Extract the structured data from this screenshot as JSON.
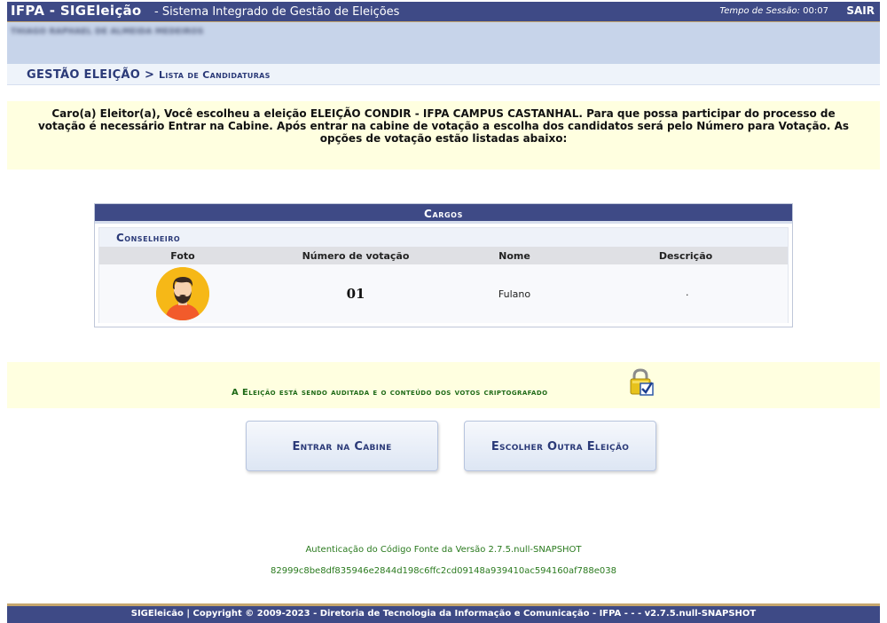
{
  "topbar": {
    "brand": "IFPA - SIGEleição",
    "subtitle": "- Sistema Integrado de Gestão de Eleições",
    "session_label": "Tempo de Sessão:",
    "session_time": "00:07",
    "exit_label": "SAIR"
  },
  "user": {
    "name": "THIAGO RAPHAEL DE ALMEIDA MEDEIROS"
  },
  "breadcrumb": {
    "section": "GESTÃO ELEIÇÃO",
    "separator": ">",
    "page": "Lista de Candidaturas"
  },
  "info": {
    "message": "Caro(a) Eleitor(a), Você escolheu a eleição ELEIÇÃO CONDIR - IFPA CAMPUS CASTANHAL. Para que possa participar do processo de votação é necessário Entrar na Cabine. Após entrar na cabine de votação a escolha dos candidatos será pelo Número para Votação. As opções de votação estão listadas abaixo:"
  },
  "cargos": {
    "title": "Cargos",
    "group": "Conselheiro",
    "columns": [
      "Foto",
      "Número de votação",
      "Nome",
      "Descrição"
    ],
    "rows": [
      {
        "numero": "01",
        "nome": "Fulano",
        "descricao": "."
      }
    ]
  },
  "audit": {
    "text": "A Eleição está sendo auditada e o conteúdo dos votos criptografado"
  },
  "buttons": {
    "cabine": "Entrar na Cabine",
    "outra": "Escolher Outra Eleição"
  },
  "footer": {
    "auth": "Autenticação do Código Fonte da Versão 2.7.5.null-SNAPSHOT",
    "hash": "82999c8be8df835946e2844d198c6ffc2cd09148a939410ac594160af788e038",
    "copyright": "SIGEleicão | Copyright © 2009-2023 - Diretoria de Tecnologia da Informação e Comunicação - IFPA - - - v2.7.5.null-SNAPSHOT"
  },
  "colors": {
    "header_blue": "#3e4a86",
    "gold_line": "#c5a66e",
    "notice_yellow": "#ffffe0",
    "green_text": "#2a7a1e"
  },
  "icons": {
    "avatar": "user-avatar-icon",
    "lock": "padlock-check-icon"
  }
}
